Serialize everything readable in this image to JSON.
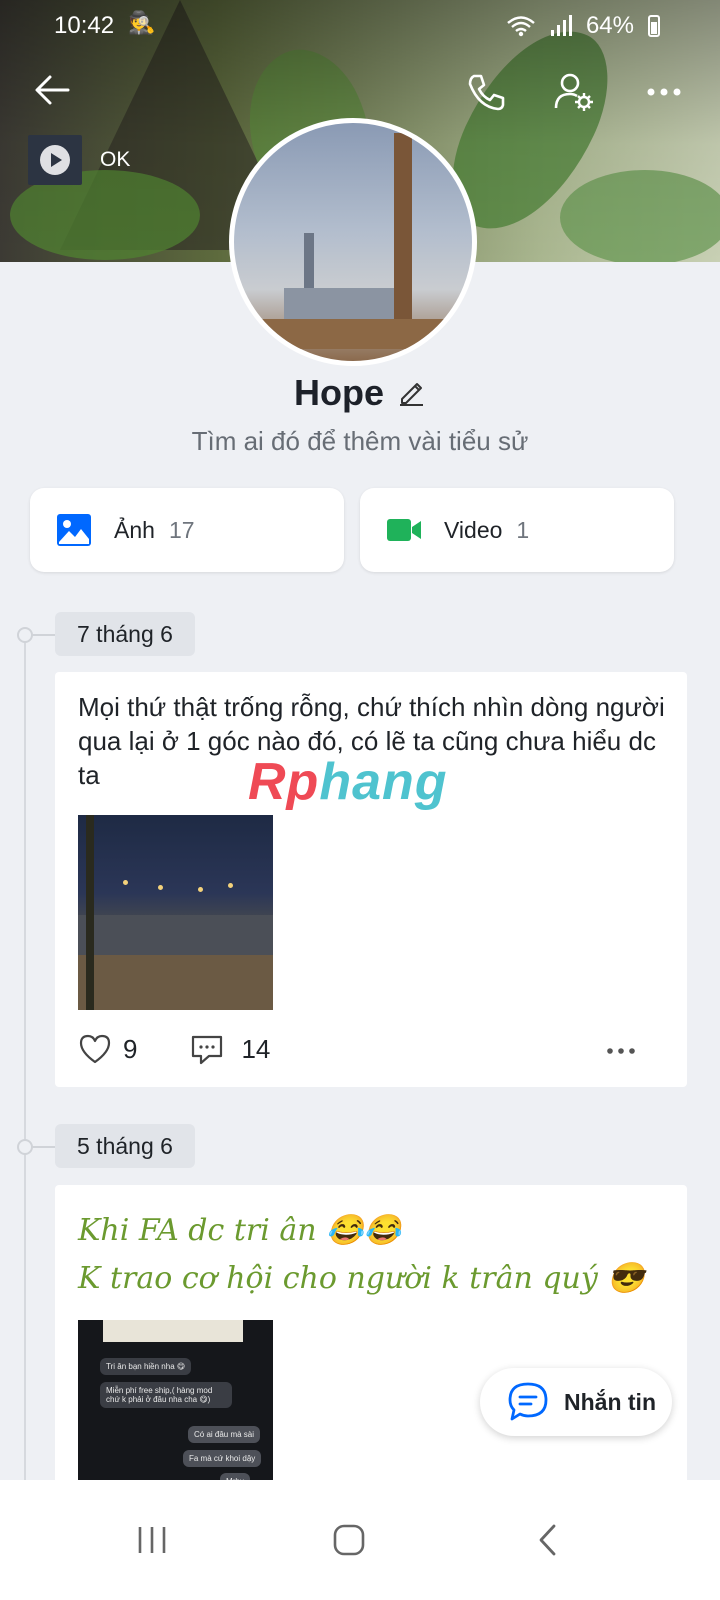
{
  "status_bar": {
    "time": "10:42",
    "battery": "64%"
  },
  "music": {
    "title": "OK"
  },
  "profile": {
    "name": "Hope",
    "bio": "Tìm ai đó để thêm vài tiểu sử"
  },
  "media": {
    "photos": {
      "label": "Ảnh",
      "count": "17"
    },
    "videos": {
      "label": "Video",
      "count": "1"
    }
  },
  "posts": [
    {
      "date": "7 tháng 6",
      "text": "Mọi thứ thật trống rỗng, chứ thích nhìn dòng người qua lại ở 1 góc nào đó, có lẽ ta cũng chưa hiểu dc ta",
      "likes": "9",
      "comments": "14"
    },
    {
      "date": "5 tháng 6",
      "text_line1": "Khi FA dc tri ân 😂😂",
      "text_line2": "K trao cơ hội cho người k trân quý 😎",
      "chat_lines": [
        "Tri ân bạn hiền nha 😋",
        "Miễn phí free ship,( hàng mod chứ k phải ở đâu nha cha 😋)",
        "Có ai đâu mà sài",
        "Fa mà cứ khoi dậy",
        "Mrhu"
      ]
    }
  ],
  "watermark": {
    "part1": "Rp",
    "part2": "hang"
  },
  "chat_button": {
    "label": "Nhắn tin"
  },
  "colors": {
    "accent": "#0068ff",
    "video_green": "#1fb25a",
    "post_green": "#6b9a2f"
  }
}
